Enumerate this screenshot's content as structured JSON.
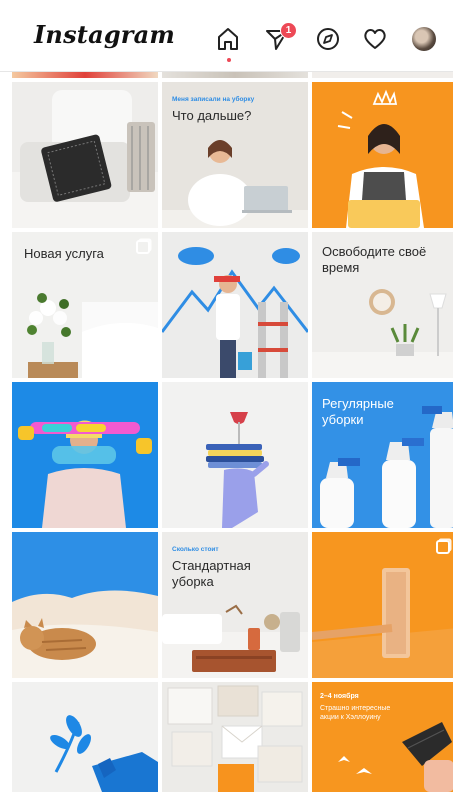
{
  "header": {
    "logo": "Instagram",
    "direct_badge_count": "1",
    "icons": [
      "home-icon",
      "direct-icon",
      "explore-icon",
      "heart-icon",
      "avatar"
    ]
  },
  "grid": {
    "tile_2_2": {
      "caption": "Меня записали на уборку",
      "title": "Что дальше?"
    },
    "tile_3_1": {
      "title": "Новая услуга"
    },
    "tile_3_3": {
      "title": "Освободите своё время"
    },
    "tile_4_3": {
      "title": "Регулярные уборки"
    },
    "tile_5_2": {
      "caption": "Сколько стоит",
      "title": "Стандартная уборка"
    },
    "tile_6_3": {
      "caption": "2–4 ноября",
      "title": "Страшно интересные акции к Хэллоуину"
    }
  },
  "colors": {
    "accent_orange": "#f7931e",
    "accent_blue": "#2f8de4",
    "badge_red": "#ed4956"
  }
}
